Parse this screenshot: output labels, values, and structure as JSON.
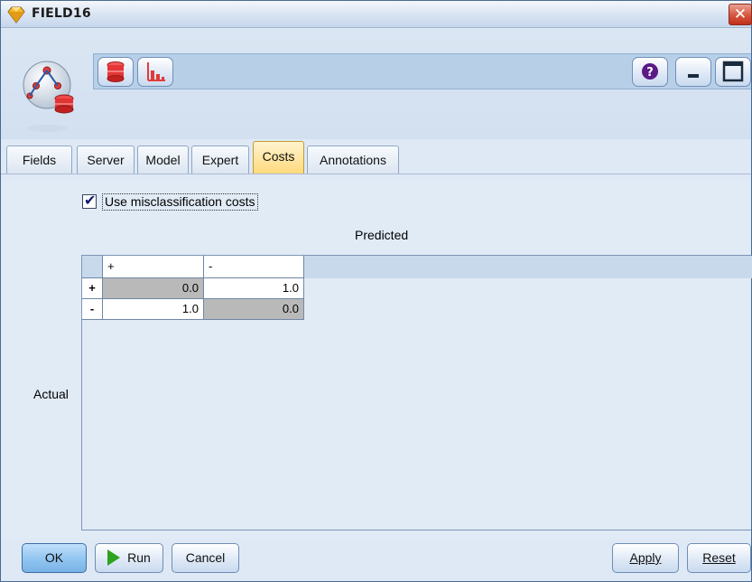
{
  "window": {
    "title": "FIELD16",
    "close_glyph": "✕"
  },
  "toolbar": {
    "icons": [
      "database-icon",
      "chart-icon"
    ],
    "help_icon": "help-icon",
    "minimize_icon": "minimize-icon",
    "maximize_icon": "maximize-icon"
  },
  "tabs": [
    {
      "label": "Fields",
      "active": false
    },
    {
      "label": "Server",
      "active": false
    },
    {
      "label": "Model",
      "active": false
    },
    {
      "label": "Expert",
      "active": false
    },
    {
      "label": "Costs",
      "active": true
    },
    {
      "label": "Annotations",
      "active": false
    }
  ],
  "costs": {
    "use_misclassification_label": "Use misclassification costs",
    "use_misclassification_checked": true,
    "predicted_label": "Predicted",
    "actual_label": "Actual",
    "columns": [
      "+",
      "-"
    ],
    "rows": [
      {
        "label": "+",
        "values": [
          "0.0",
          "1.0"
        ]
      },
      {
        "label": "-",
        "values": [
          "1.0",
          "0.0"
        ]
      }
    ]
  },
  "buttons": {
    "ok": "OK",
    "run": "Run",
    "cancel": "Cancel",
    "apply": "Apply",
    "reset": "Reset"
  },
  "colors": {
    "active_tab": "#ffd97a",
    "diagonal_cell": "#b9b9b9",
    "close_button": "#d5553e"
  }
}
